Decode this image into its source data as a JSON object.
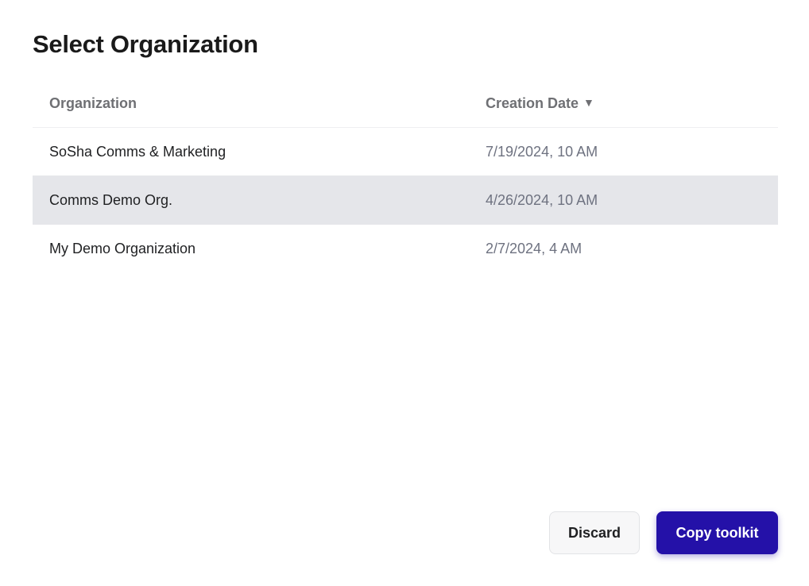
{
  "dialog": {
    "title": "Select Organization"
  },
  "table": {
    "columns": {
      "organization": "Organization",
      "creation_date": "Creation Date",
      "sort_indicator": "▼"
    },
    "rows": [
      {
        "organization": "SoSha Comms & Marketing",
        "creation_date": "7/19/2024, 10 AM",
        "selected": false
      },
      {
        "organization": "Comms Demo Org.",
        "creation_date": "4/26/2024, 10 AM",
        "selected": true
      },
      {
        "organization": "My Demo Organization",
        "creation_date": "2/7/2024, 4 AM",
        "selected": false
      }
    ]
  },
  "actions": {
    "discard_label": "Discard",
    "copy_label": "Copy toolkit"
  },
  "colors": {
    "primary": "#2411a8",
    "selected_row": "#e5e6ea",
    "muted_text": "#6e7280"
  },
  "icons": {
    "sort": "sort-descending-icon"
  }
}
